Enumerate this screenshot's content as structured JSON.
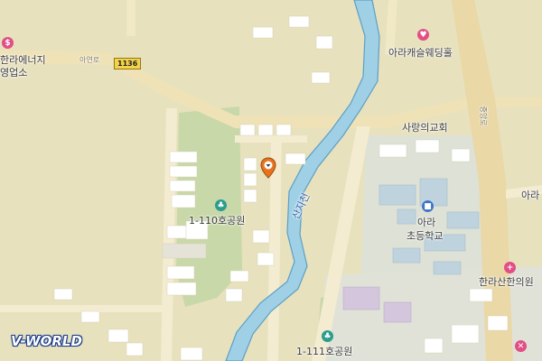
{
  "map": {
    "place_labels": [
      {
        "key": "hanra_energy_1",
        "text": "한라에너지"
      },
      {
        "key": "hanra_energy_2",
        "text": "영업소"
      },
      {
        "key": "arakaeul",
        "text": "아라캐슬웨딩홀"
      },
      {
        "key": "sarang",
        "text": "사랑의교회"
      },
      {
        "key": "park110",
        "text": "1-110호공원"
      },
      {
        "key": "ara_school_1",
        "text": "아라"
      },
      {
        "key": "ara_school_2",
        "text": "초등학교"
      },
      {
        "key": "hanrasan",
        "text": "한라산한의원"
      },
      {
        "key": "park111",
        "text": "1-111호공원"
      },
      {
        "key": "right_edge",
        "text": "아라"
      }
    ],
    "road_labels": {
      "ayeon": "아연로",
      "jungang": "중앙로"
    },
    "route_shield": "1136",
    "river_label": "산지천",
    "logo": "V-WORLD",
    "colors": {
      "land": "#e7e1bd",
      "road": "#f1e6bf",
      "road_major": "#ecd9a8",
      "river": "#9fd0e6",
      "river_edge": "#5c9fc4",
      "green": "#c3d5a3",
      "building": "#ffffff",
      "school_area": "#dcdfd6",
      "school_bldg": "#bfd3de",
      "marker": "#e8731c",
      "poi_pink": "#e14f86",
      "poi_blue": "#3f74c9",
      "poi_teal": "#2a9d8f"
    },
    "icons": [
      "location-pin-icon",
      "shop-icon",
      "wedding-icon",
      "school-icon",
      "park-icon",
      "hospital-icon",
      "route-shield-icon"
    ]
  }
}
